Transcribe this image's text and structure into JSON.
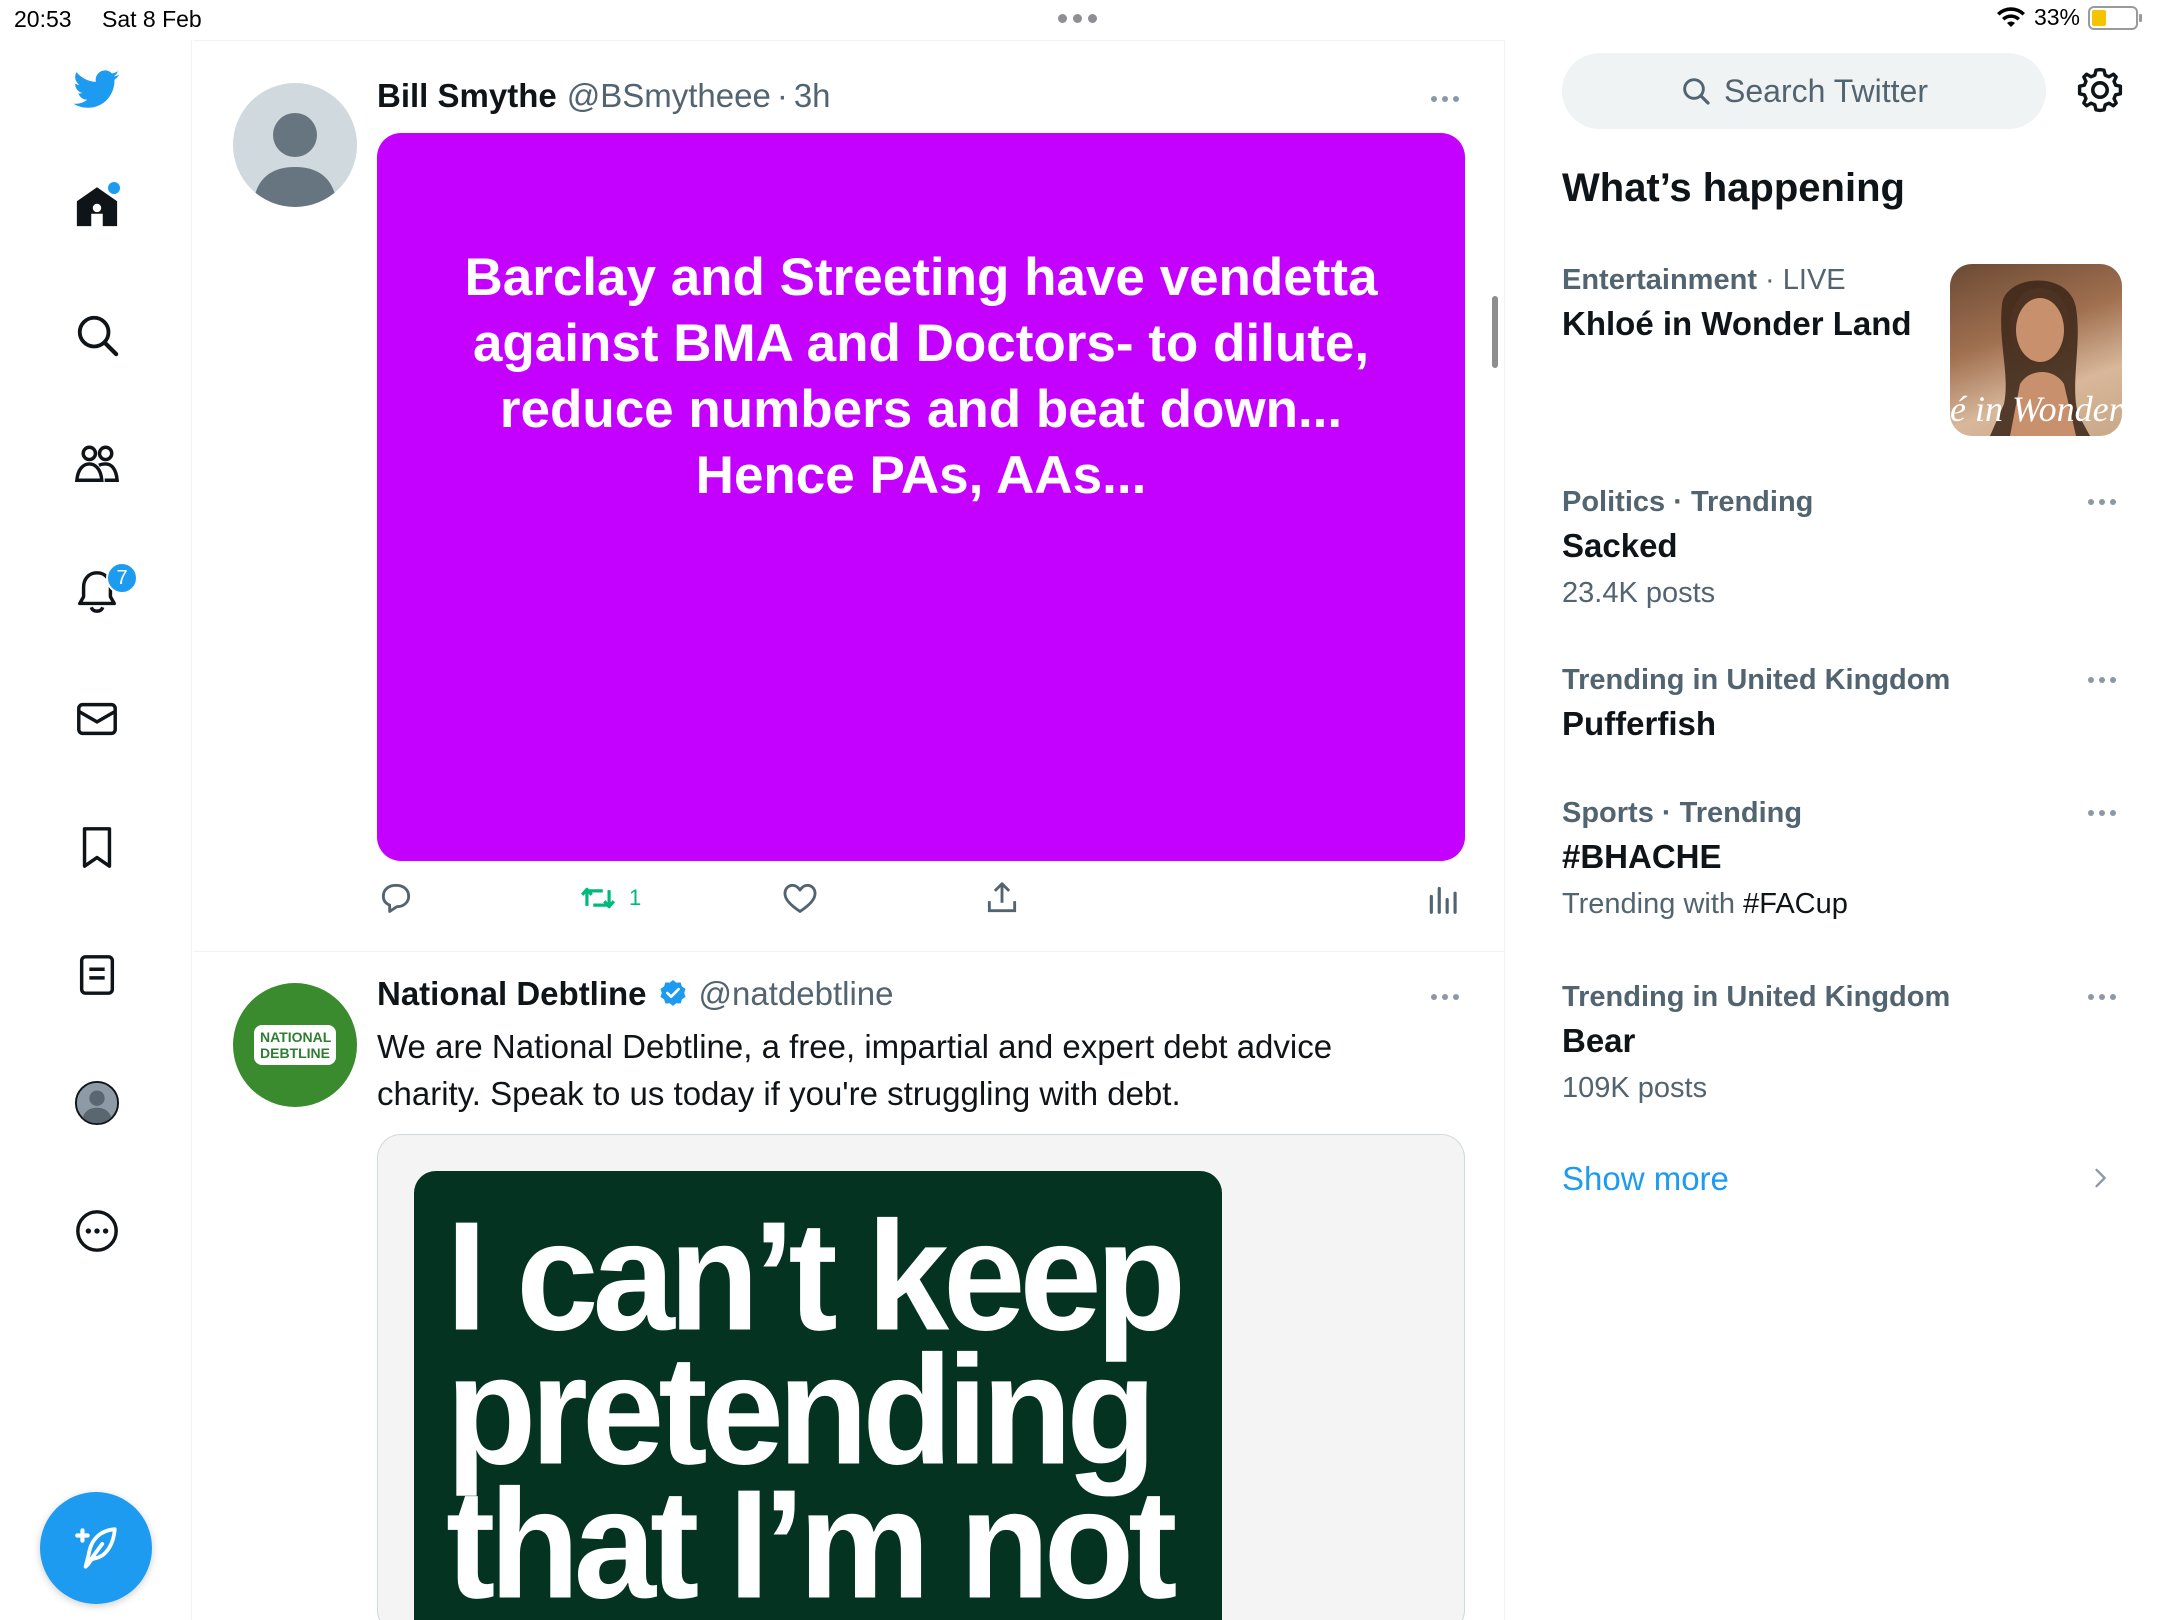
{
  "status_bar": {
    "time": "20:53",
    "date": "Sat 8 Feb",
    "battery_percent": "33%",
    "battery_level": 0.33
  },
  "nav": {
    "items": [
      {
        "name": "twitter-logo",
        "icon": "bird-icon"
      },
      {
        "name": "home",
        "icon": "home-icon",
        "has_new": true
      },
      {
        "name": "explore",
        "icon": "search-icon"
      },
      {
        "name": "communities",
        "icon": "people-icon"
      },
      {
        "name": "notifications",
        "icon": "bell-icon",
        "badge": "7"
      },
      {
        "name": "messages",
        "icon": "mail-icon"
      },
      {
        "name": "bookmarks",
        "icon": "bookmark-icon"
      },
      {
        "name": "lists",
        "icon": "list-icon"
      },
      {
        "name": "profile",
        "icon": "avatar-icon"
      },
      {
        "name": "more",
        "icon": "more-circle-icon"
      }
    ],
    "compose_icon": "feather-plus-icon"
  },
  "timeline": {
    "tweets": [
      {
        "name": "Bill Smythe",
        "handle": "@BSmytheee",
        "separator": "·",
        "time": "3h",
        "media_text": "Barclay and Streeting have vendetta against BMA and Doctors- to dilute, reduce numbers and beat down...\nHence PAs, AAs...",
        "media_color": "#c400ff",
        "retweet_count": "1",
        "accent_retweet": "#00ba7c"
      },
      {
        "name": "National Debtline",
        "verified": true,
        "handle": "@natdebtline",
        "avatar_text": "NATIONAL DEBTLINE",
        "text": "We are National Debtline, a free, impartial and expert debt advice charity. Speak to us today if you're struggling with debt.",
        "ad_lines": [
          "I can’t keep",
          "pretending",
          "that I’m not"
        ],
        "ad_color": "#053321"
      }
    ]
  },
  "sidebar": {
    "search_placeholder": "Search Twitter",
    "section_title": "What’s happening",
    "trends": [
      {
        "category": "Entertainment",
        "sep": " · ",
        "qualifier": "LIVE",
        "title": "Khloé in Wonder Land",
        "thumb_text": "é in Wonder L"
      },
      {
        "category": "Politics",
        "sep": " · ",
        "qualifier": "Trending",
        "title": "Sacked",
        "sub": "23.4K posts"
      },
      {
        "category": "Trending in United Kingdom",
        "title": "Pufferfish"
      },
      {
        "category": "Sports",
        "sep": " · ",
        "qualifier": "Trending",
        "title": "#BHACHE",
        "sub_prefix": "Trending with ",
        "sub_tag": "#FACup"
      },
      {
        "category": "Trending in United Kingdom",
        "title": "Bear",
        "sub": "109K posts"
      }
    ],
    "show_more": "Show more",
    "accent": "#1d9bf0"
  }
}
